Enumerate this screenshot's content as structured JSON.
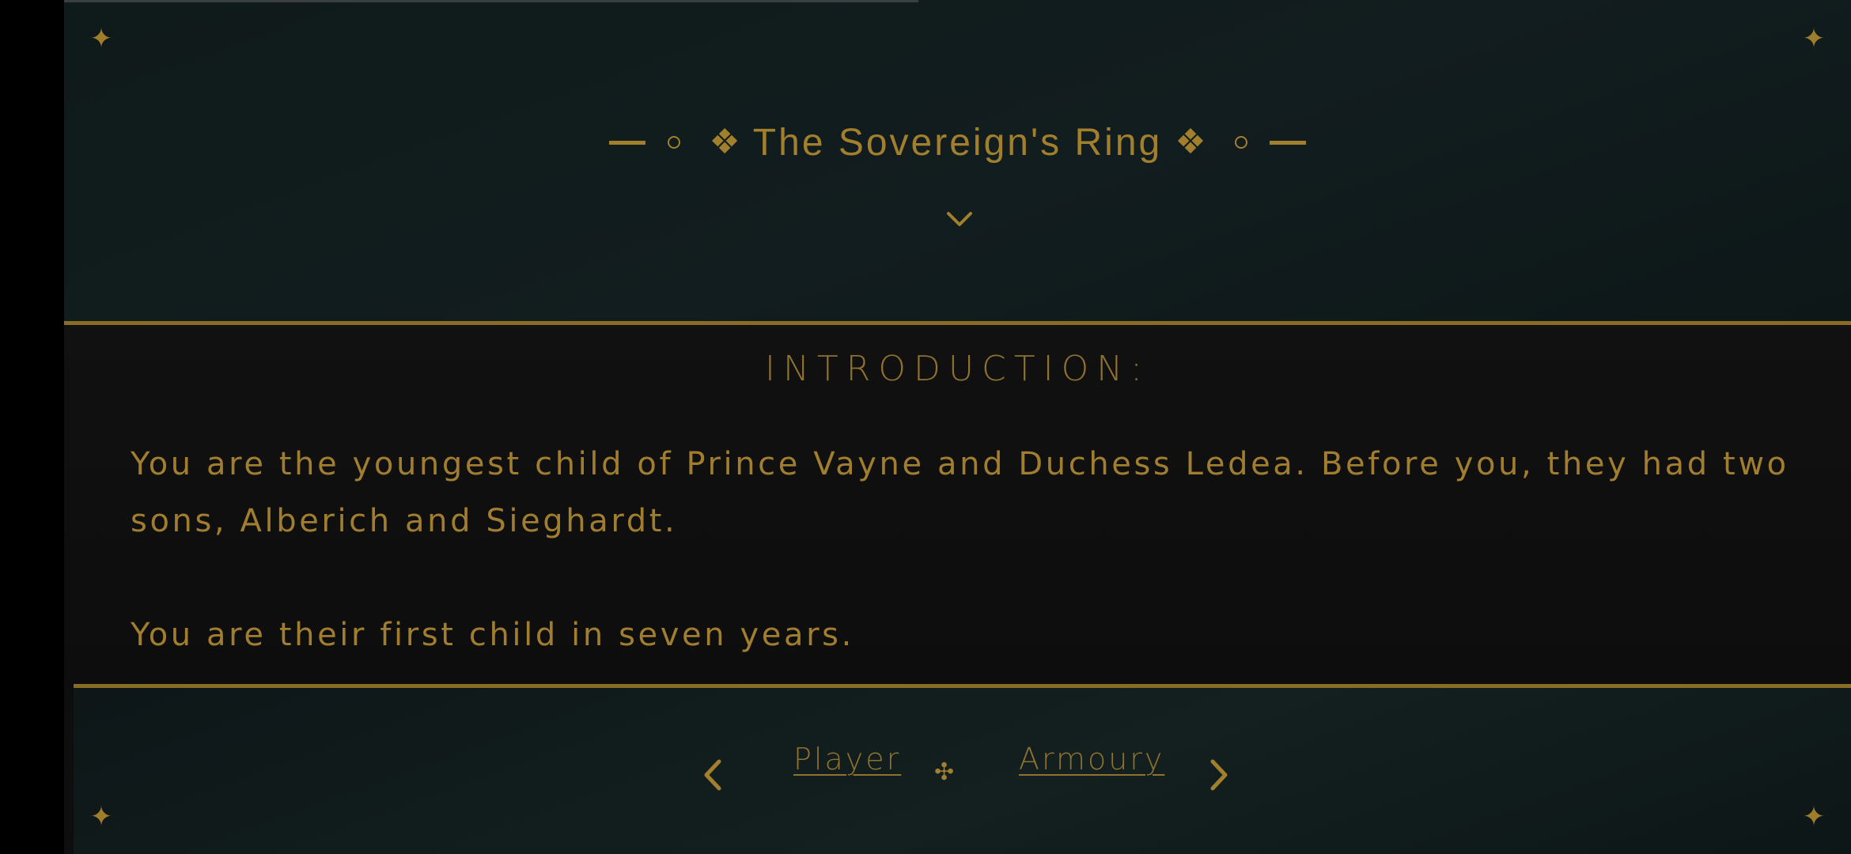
{
  "story": {
    "title": "The Sovereign's Ring"
  },
  "section": {
    "heading": "INTRODUCTION:",
    "paragraphs": [
      "You are the youngest child of Prince Vayne and Duchess Ledea. Before you, they had two sons, Alberich and Sieghardt.",
      "You are their first child in seven years."
    ]
  },
  "navigation": {
    "prev_label": "Player",
    "next_label": "Armoury"
  },
  "ornaments": {
    "corner_glyph": "✦",
    "title_glyph": "❖",
    "divider_glyph": "✣"
  },
  "colors": {
    "accent": "#a27f2c",
    "rule": "#8a6d24",
    "background": "#0e0e0e"
  }
}
